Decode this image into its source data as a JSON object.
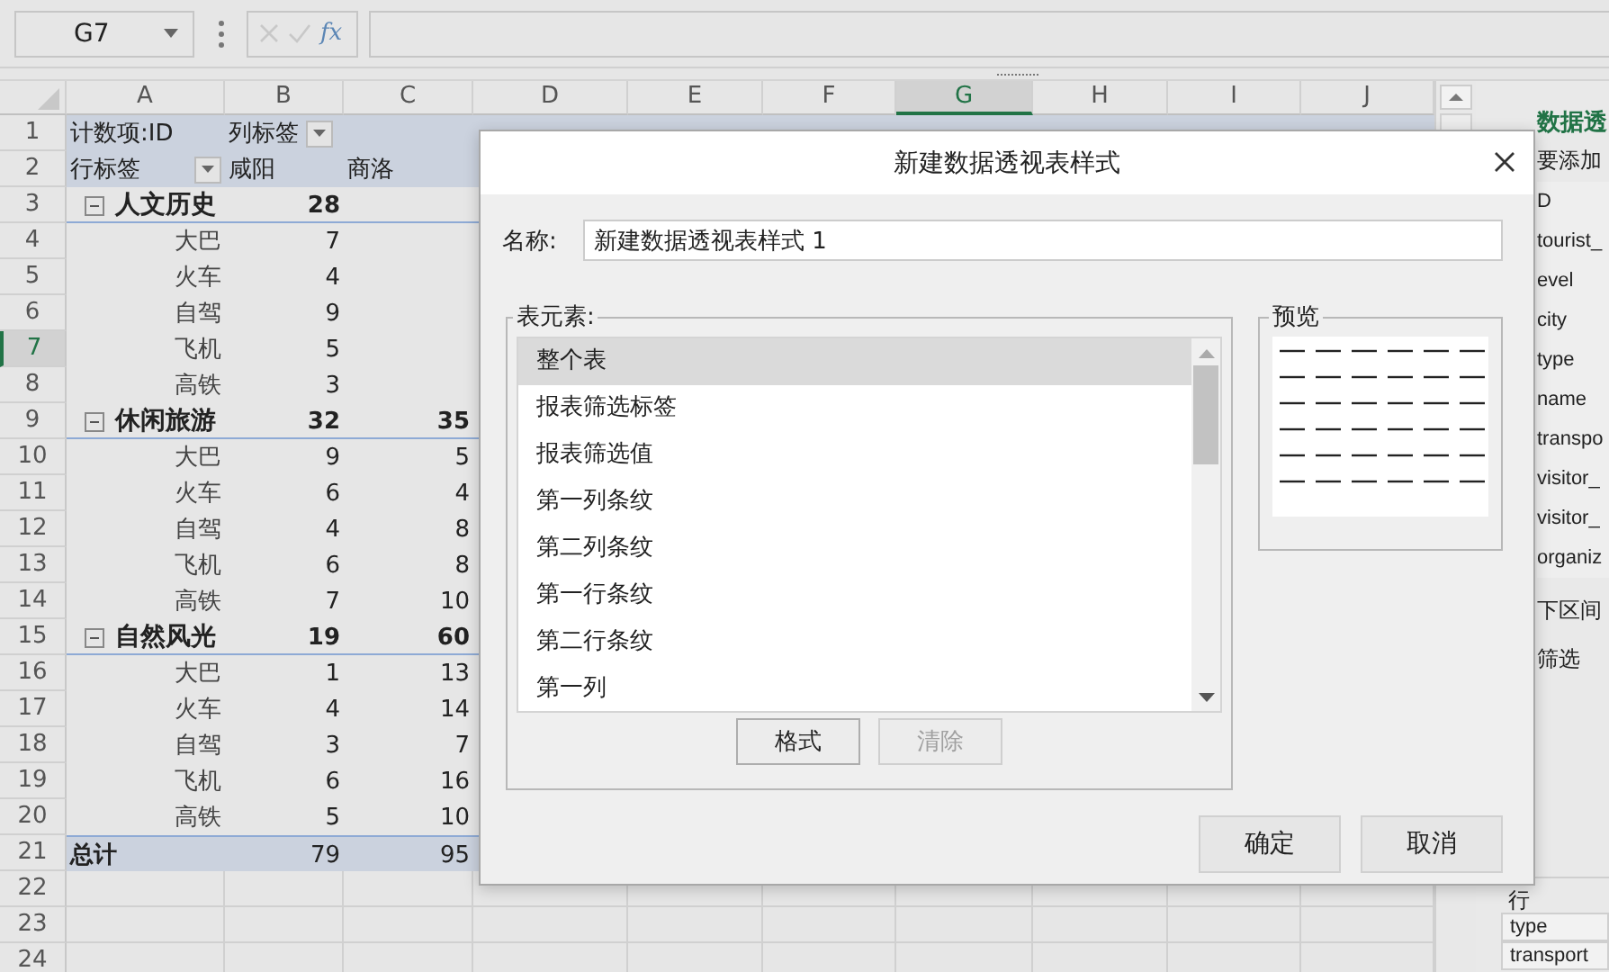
{
  "formula_bar": {
    "name_box": "G7",
    "fx": "fx"
  },
  "columns": [
    {
      "label": "A",
      "selected": false
    },
    {
      "label": "B",
      "selected": false
    },
    {
      "label": "C",
      "selected": false
    },
    {
      "label": "D",
      "selected": false
    },
    {
      "label": "E",
      "selected": false
    },
    {
      "label": "F",
      "selected": false
    },
    {
      "label": "G",
      "selected": true
    },
    {
      "label": "H",
      "selected": false
    },
    {
      "label": "I",
      "selected": false
    },
    {
      "label": "J",
      "selected": false
    }
  ],
  "row_headers": [
    {
      "label": "1",
      "selected": false
    },
    {
      "label": "2",
      "selected": false
    },
    {
      "label": "3",
      "selected": false
    },
    {
      "label": "4",
      "selected": false
    },
    {
      "label": "5",
      "selected": false
    },
    {
      "label": "6",
      "selected": false
    },
    {
      "label": "7",
      "selected": true
    },
    {
      "label": "8",
      "selected": false
    },
    {
      "label": "9",
      "selected": false
    },
    {
      "label": "10",
      "selected": false
    },
    {
      "label": "11",
      "selected": false
    },
    {
      "label": "12",
      "selected": false
    },
    {
      "label": "13",
      "selected": false
    },
    {
      "label": "14",
      "selected": false
    },
    {
      "label": "15",
      "selected": false
    },
    {
      "label": "16",
      "selected": false
    },
    {
      "label": "17",
      "selected": false
    },
    {
      "label": "18",
      "selected": false
    },
    {
      "label": "19",
      "selected": false
    },
    {
      "label": "20",
      "selected": false
    },
    {
      "label": "21",
      "selected": false
    },
    {
      "label": "22",
      "selected": false
    },
    {
      "label": "23",
      "selected": false
    },
    {
      "label": "24",
      "selected": false
    }
  ],
  "pivot": {
    "value_label": "计数项:ID",
    "col_label": "列标签",
    "row_label": "行标签",
    "columns": [
      "咸阳",
      "商洛"
    ],
    "groups": [
      {
        "name": "人文历史",
        "expanded": true,
        "values": [
          "28"
        ],
        "items": [
          {
            "name": "大巴",
            "values": [
              "7"
            ]
          },
          {
            "name": "火车",
            "values": [
              "4"
            ]
          },
          {
            "name": "自驾",
            "values": [
              "9"
            ]
          },
          {
            "name": "飞机",
            "values": [
              "5"
            ]
          },
          {
            "name": "高铁",
            "values": [
              "3"
            ]
          }
        ]
      },
      {
        "name": "休闲旅游",
        "expanded": true,
        "values": [
          "32",
          "35"
        ],
        "items": [
          {
            "name": "大巴",
            "values": [
              "9",
              "5"
            ]
          },
          {
            "name": "火车",
            "values": [
              "6",
              "4"
            ]
          },
          {
            "name": "自驾",
            "values": [
              "4",
              "8"
            ]
          },
          {
            "name": "飞机",
            "values": [
              "6",
              "8"
            ]
          },
          {
            "name": "高铁",
            "values": [
              "7",
              "10"
            ]
          }
        ]
      },
      {
        "name": "自然风光",
        "expanded": true,
        "values": [
          "19",
          "60"
        ],
        "items": [
          {
            "name": "大巴",
            "values": [
              "1",
              "13"
            ]
          },
          {
            "name": "火车",
            "values": [
              "4",
              "14"
            ]
          },
          {
            "name": "自驾",
            "values": [
              "3",
              "7"
            ]
          },
          {
            "name": "飞机",
            "values": [
              "6",
              "16"
            ]
          },
          {
            "name": "高铁",
            "values": [
              "5",
              "10"
            ]
          }
        ]
      }
    ],
    "total": {
      "label": "总计",
      "values": [
        "79",
        "95"
      ]
    }
  },
  "field_pane": {
    "title": "数据透",
    "hint": "要添加",
    "fields": [
      "D",
      "tourist_",
      "evel",
      "city",
      "type",
      "name",
      "transpo",
      "visitor_",
      "visitor_",
      "organiz"
    ],
    "sections": [
      "下区间",
      "筛选"
    ],
    "area_label": "行",
    "area_fields": [
      "type",
      "transport"
    ]
  },
  "dialog": {
    "title": "新建数据透视表样式",
    "name_label": "名称:",
    "name_value": "新建数据透视表样式 1",
    "elements_label": "表元素:",
    "elements": [
      {
        "label": "整个表",
        "selected": true
      },
      {
        "label": "报表筛选标签",
        "selected": false
      },
      {
        "label": "报表筛选值",
        "selected": false
      },
      {
        "label": "第一列条纹",
        "selected": false
      },
      {
        "label": "第二列条纹",
        "selected": false
      },
      {
        "label": "第一行条纹",
        "selected": false
      },
      {
        "label": "第二行条纹",
        "selected": false
      },
      {
        "label": "第一列",
        "selected": false
      }
    ],
    "element_buttons": [
      {
        "label": "格式",
        "disabled": false
      },
      {
        "label": "清除",
        "disabled": true
      }
    ],
    "preview_label": "预览",
    "actions": [
      "确定",
      "取消"
    ]
  }
}
